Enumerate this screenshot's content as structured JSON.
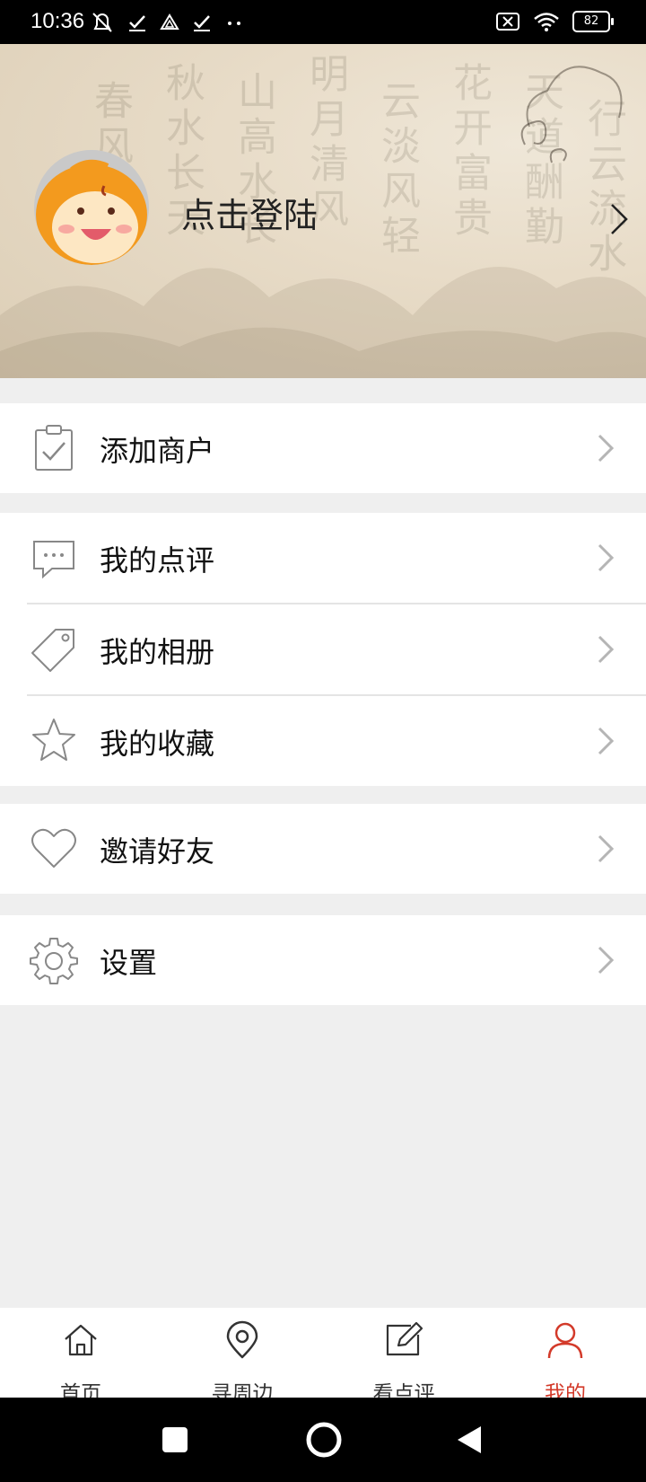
{
  "status_bar": {
    "time": "10:36",
    "battery": "82"
  },
  "header": {
    "login_text": "点击登陆"
  },
  "menu": {
    "group1": [
      {
        "label": "添加商户",
        "icon": "clipboard-check-icon"
      }
    ],
    "group2": [
      {
        "label": "我的点评",
        "icon": "chat-bubble-icon"
      },
      {
        "label": "我的相册",
        "icon": "tag-icon"
      },
      {
        "label": "我的收藏",
        "icon": "star-icon"
      }
    ],
    "group3": [
      {
        "label": "邀请好友",
        "icon": "heart-icon"
      }
    ],
    "group4": [
      {
        "label": "设置",
        "icon": "gear-icon"
      }
    ]
  },
  "tabbar": {
    "tabs": [
      {
        "label": "首页",
        "icon": "home-icon"
      },
      {
        "label": "寻周边",
        "icon": "location-pin-icon"
      },
      {
        "label": "看点评",
        "icon": "edit-icon"
      },
      {
        "label": "我的",
        "icon": "user-icon",
        "active": true
      }
    ],
    "active_color": "#d33a2a"
  }
}
